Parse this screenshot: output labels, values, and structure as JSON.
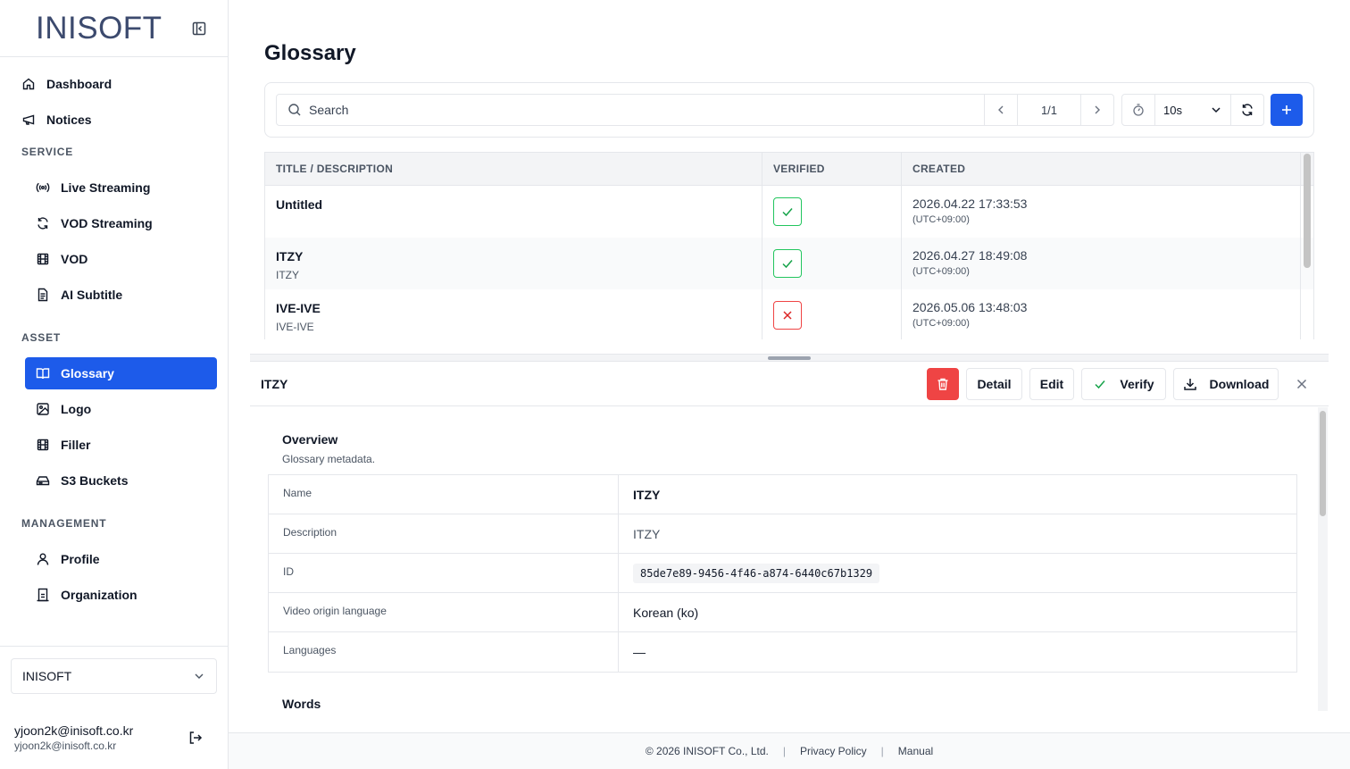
{
  "brand": {
    "name": "INISOFT"
  },
  "nav": {
    "top": [
      {
        "label": "Dashboard"
      },
      {
        "label": "Notices"
      }
    ],
    "sections": [
      {
        "title": "SERVICE",
        "items": [
          {
            "label": "Live Streaming"
          },
          {
            "label": "VOD Streaming"
          },
          {
            "label": "VOD"
          },
          {
            "label": "AI Subtitle"
          }
        ]
      },
      {
        "title": "ASSET",
        "items": [
          {
            "label": "Glossary",
            "active": true
          },
          {
            "label": "Logo"
          },
          {
            "label": "Filler"
          },
          {
            "label": "S3 Buckets"
          }
        ]
      },
      {
        "title": "MANAGEMENT",
        "items": [
          {
            "label": "Profile"
          },
          {
            "label": "Organization"
          }
        ]
      }
    ]
  },
  "org_selector": {
    "value": "INISOFT"
  },
  "user": {
    "email": "yjoon2k@inisoft.co.kr",
    "email_sub": "yjoon2k@inisoft.co.kr"
  },
  "page": {
    "title": "Glossary"
  },
  "toolbar": {
    "search_placeholder": "Search",
    "pagination": "1/1",
    "refresh_interval": "10s"
  },
  "table": {
    "headers": [
      "TITLE / DESCRIPTION",
      "VERIFIED",
      "CREATED"
    ],
    "rows": [
      {
        "title": "Untitled",
        "description": "",
        "verified": true,
        "created": "2026.04.22 17:33:53",
        "tz": "(UTC+09:00)"
      },
      {
        "title": "ITZY",
        "description": "ITZY",
        "verified": true,
        "created": "2026.04.27 18:49:08",
        "tz": "(UTC+09:00)"
      },
      {
        "title": "IVE-IVE",
        "description": "IVE-IVE",
        "verified": false,
        "created": "2026.05.06 13:48:03",
        "tz": "(UTC+09:00)"
      }
    ]
  },
  "detail": {
    "title": "ITZY",
    "buttons": {
      "detail": "Detail",
      "edit": "Edit",
      "verify": "Verify",
      "download": "Download"
    },
    "overview_title": "Overview",
    "overview_subtitle": "Glossary metadata.",
    "fields": [
      {
        "key": "Name",
        "value": "ITZY"
      },
      {
        "key": "Description",
        "value": "ITZY"
      },
      {
        "key": "ID",
        "value": "85de7e89-9456-4f46-a874-6440c67b1329"
      },
      {
        "key": "Video origin language",
        "value": "Korean (ko)"
      },
      {
        "key": "Languages",
        "value": "—"
      }
    ],
    "words_title": "Words"
  },
  "footer": {
    "copyright": "© 2026 INISOFT Co., Ltd.",
    "privacy": "Privacy Policy",
    "manual": "Manual"
  },
  "colors": {
    "accent": "#1d5bea",
    "danger": "#ef4444",
    "success": "#16a34a"
  }
}
